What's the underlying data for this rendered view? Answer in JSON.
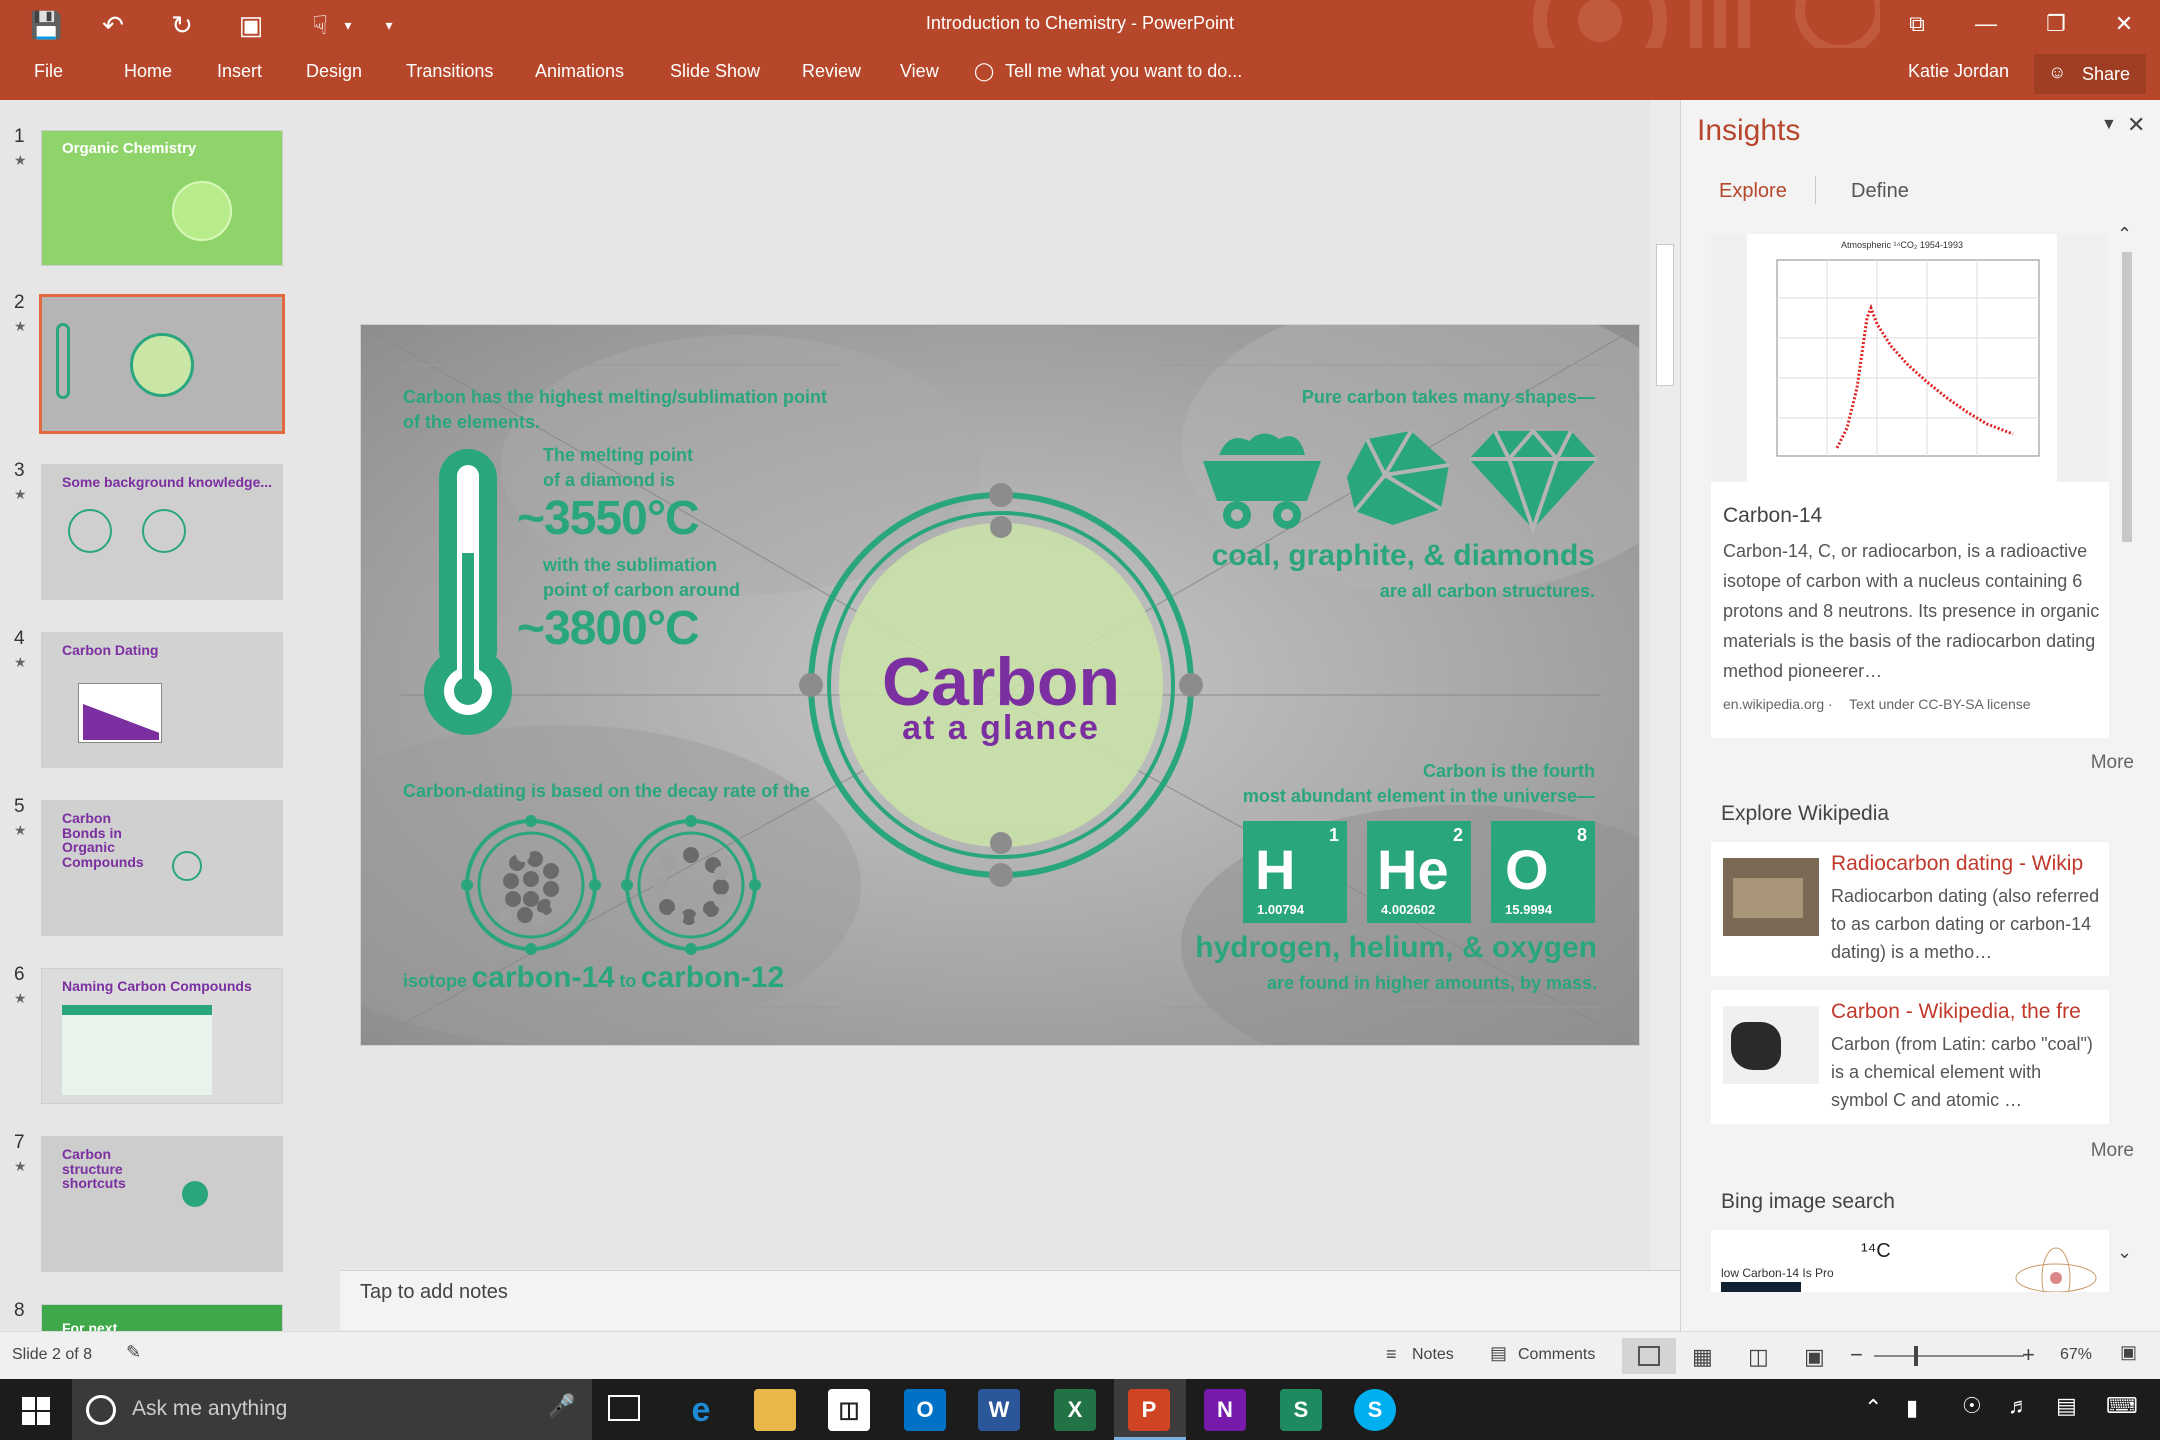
{
  "window": {
    "title": "Introduction to Chemistry - PowerPoint",
    "user": "Katie Jordan",
    "share_label": "Share"
  },
  "ribbon": {
    "tabs": [
      "File",
      "Home",
      "Insert",
      "Design",
      "Transitions",
      "Animations",
      "Slide Show",
      "Review",
      "View"
    ],
    "tell_me": "Tell me what you want to do..."
  },
  "thumbnails": [
    {
      "num": "1",
      "title": "Organic Chemistry"
    },
    {
      "num": "2",
      "title": "Carbon at a glance"
    },
    {
      "num": "3",
      "title": "Some background knowledge..."
    },
    {
      "num": "4",
      "title": "Carbon Dating"
    },
    {
      "num": "5",
      "title": "Carbon Bonds in Organic Compounds"
    },
    {
      "num": "6",
      "title": "Naming Carbon Compounds"
    },
    {
      "num": "7",
      "title": "Carbon structure shortcuts"
    },
    {
      "num": "8",
      "title": "For next"
    }
  ],
  "slide": {
    "melting_intro": "Carbon has the highest melting/sublimation point of the elements.",
    "melting_point_label": "The melting point of a diamond is",
    "melting_value": "~3550°C",
    "sublimation_label": "with the sublimation point of carbon around",
    "sublimation_value": "~3800°C",
    "dating_label": "Carbon-dating is based on the decay rate of the",
    "isotope_prefix": "isotope",
    "isotope_c14": "carbon-14",
    "isotope_to": "to",
    "isotope_c12": "carbon-12",
    "center_title": "Carbon",
    "center_subtitle": "at a glance",
    "shapes_label": "Pure carbon takes many shapes—",
    "shapes_list": "coal, graphite, & diamonds",
    "shapes_note": "are all carbon structures.",
    "abundant_label_1": "Carbon is the fourth",
    "abundant_label_2": "most abundant element in the universe—",
    "elements": [
      {
        "symbol": "H",
        "number": "1",
        "mass": "1.00794"
      },
      {
        "symbol": "He",
        "number": "2",
        "mass": "4.002602"
      },
      {
        "symbol": "O",
        "number": "8",
        "mass": "15.9994"
      }
    ],
    "elements_list": "hydrogen, helium, & oxygen",
    "elements_note": "are found in higher amounts, by mass."
  },
  "notes_placeholder": "Tap to add notes",
  "insights": {
    "title": "Insights",
    "tabs": [
      "Explore",
      "Define"
    ],
    "card_title": "Carbon-14",
    "card_text": "Carbon-14, C, or radiocarbon, is a radioactive isotope of carbon with a nucleus containing 6 protons and 8 neutrons. Its presence in organic materials is the basis of the radiocarbon dating method pioneerer…",
    "card_source": "en.wikipedia.org ·",
    "card_license": "Text under CC-BY-SA license",
    "chart_caption": "Atmospheric ¹⁴CO₂ 1954-1993",
    "more_label": "More",
    "wiki_heading": "Explore Wikipedia",
    "wiki_items": [
      {
        "title": "Radiocarbon dating - Wikip",
        "text": "Radiocarbon dating (also referred to as carbon dating or carbon-14 dating) is a metho…"
      },
      {
        "title": "Carbon - Wikipedia, the fre",
        "text": "Carbon (from Latin: carbo \"coal\") is a chemical element with symbol C and atomic …"
      }
    ],
    "bing_heading": "Bing image search",
    "bing_caption": "low Carbon-14 Is Pro"
  },
  "status": {
    "slide_indicator": "Slide 2 of 8",
    "notes_label": "Notes",
    "comments_label": "Comments",
    "zoom": "67%"
  },
  "taskbar": {
    "search_placeholder": "Ask me anything"
  },
  "colors": {
    "accent": "#b7472a",
    "slide_green": "#2aa67e",
    "slide_purple": "#7b2fa0"
  }
}
